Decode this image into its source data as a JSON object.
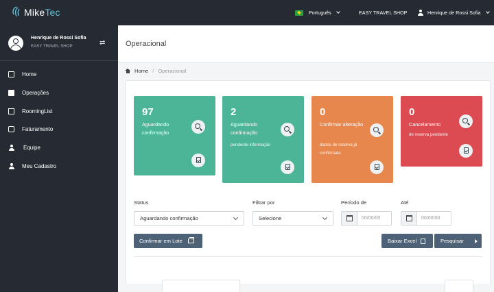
{
  "app": {
    "logo_prefix": "Mike",
    "logo_suffix": "Tec"
  },
  "topbar": {
    "language": "Português",
    "agency": "EASY TRAVEL SHOP",
    "user": "Henrique de Rossi Sofia"
  },
  "profile": {
    "name": "Henrique de Rossi Sofia",
    "shop": "EASY TRAVEL SHOP"
  },
  "sidebar": {
    "items": [
      {
        "label": "Home",
        "icon": "home-icon"
      },
      {
        "label": "Operações",
        "icon": "operations-icon"
      },
      {
        "label": "RoomingList",
        "icon": "rooming-list-icon"
      },
      {
        "label": "Faturamento",
        "icon": "billing-icon"
      },
      {
        "label": "Equipe",
        "icon": "team-icon"
      },
      {
        "label": "Meu Cadastro",
        "icon": "user-icon"
      }
    ]
  },
  "page": {
    "title": "Operacional"
  },
  "breadcrumb": {
    "home": "Home",
    "separator": "/",
    "current": "Operacional"
  },
  "cards": [
    {
      "count": "97",
      "title": "Aguardando confirmação",
      "subtitle": "",
      "color": "#4db597"
    },
    {
      "count": "2",
      "title": "Aguardando confirmação",
      "subtitle": "pendente informação",
      "color": "#4db597"
    },
    {
      "count": "0",
      "title": "Confirmar alteração",
      "subtitle": "dados de reserva já confirmada",
      "color": "#e8874d"
    },
    {
      "count": "0",
      "title": "Cancelamento",
      "subtitle": "de reserva pendente",
      "color": "#dc4b52"
    }
  ],
  "filters": {
    "status_label": "Status",
    "status_value": "Aguardando confirmação",
    "filter_by_label": "Filtrar por",
    "filter_by_value": "Selecione",
    "period_label": "Período de",
    "period_from_placeholder": "00/00/00",
    "until_label": "Até",
    "period_to_placeholder": "00/00/00"
  },
  "actions": {
    "batch_confirm": "Confirmar em Lote",
    "download_excel": "Baixar Excel",
    "search": "Pesquisar"
  }
}
